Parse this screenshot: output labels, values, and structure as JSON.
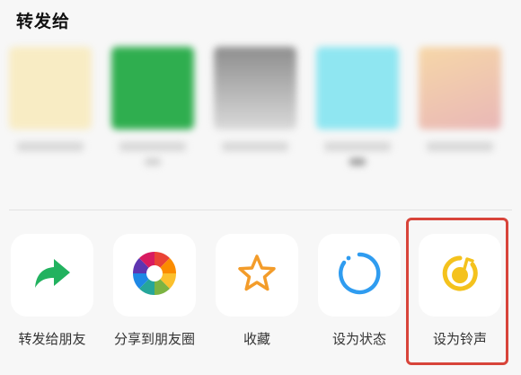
{
  "title": "转发给",
  "actions": [
    {
      "label": "转发给朋友",
      "icon": "forward-arrow-icon"
    },
    {
      "label": "分享到朋友圈",
      "icon": "moments-aperture-icon"
    },
    {
      "label": "收藏",
      "icon": "star-icon"
    },
    {
      "label": "设为状态",
      "icon": "status-ring-icon"
    },
    {
      "label": "设为铃声",
      "icon": "ringtone-music-icon"
    }
  ],
  "colors": {
    "forward": "#22b25f",
    "star": "#f39c2a",
    "status": "#2f9cf0",
    "ringtone": "#f4c21d",
    "highlight": "#d8443a"
  }
}
